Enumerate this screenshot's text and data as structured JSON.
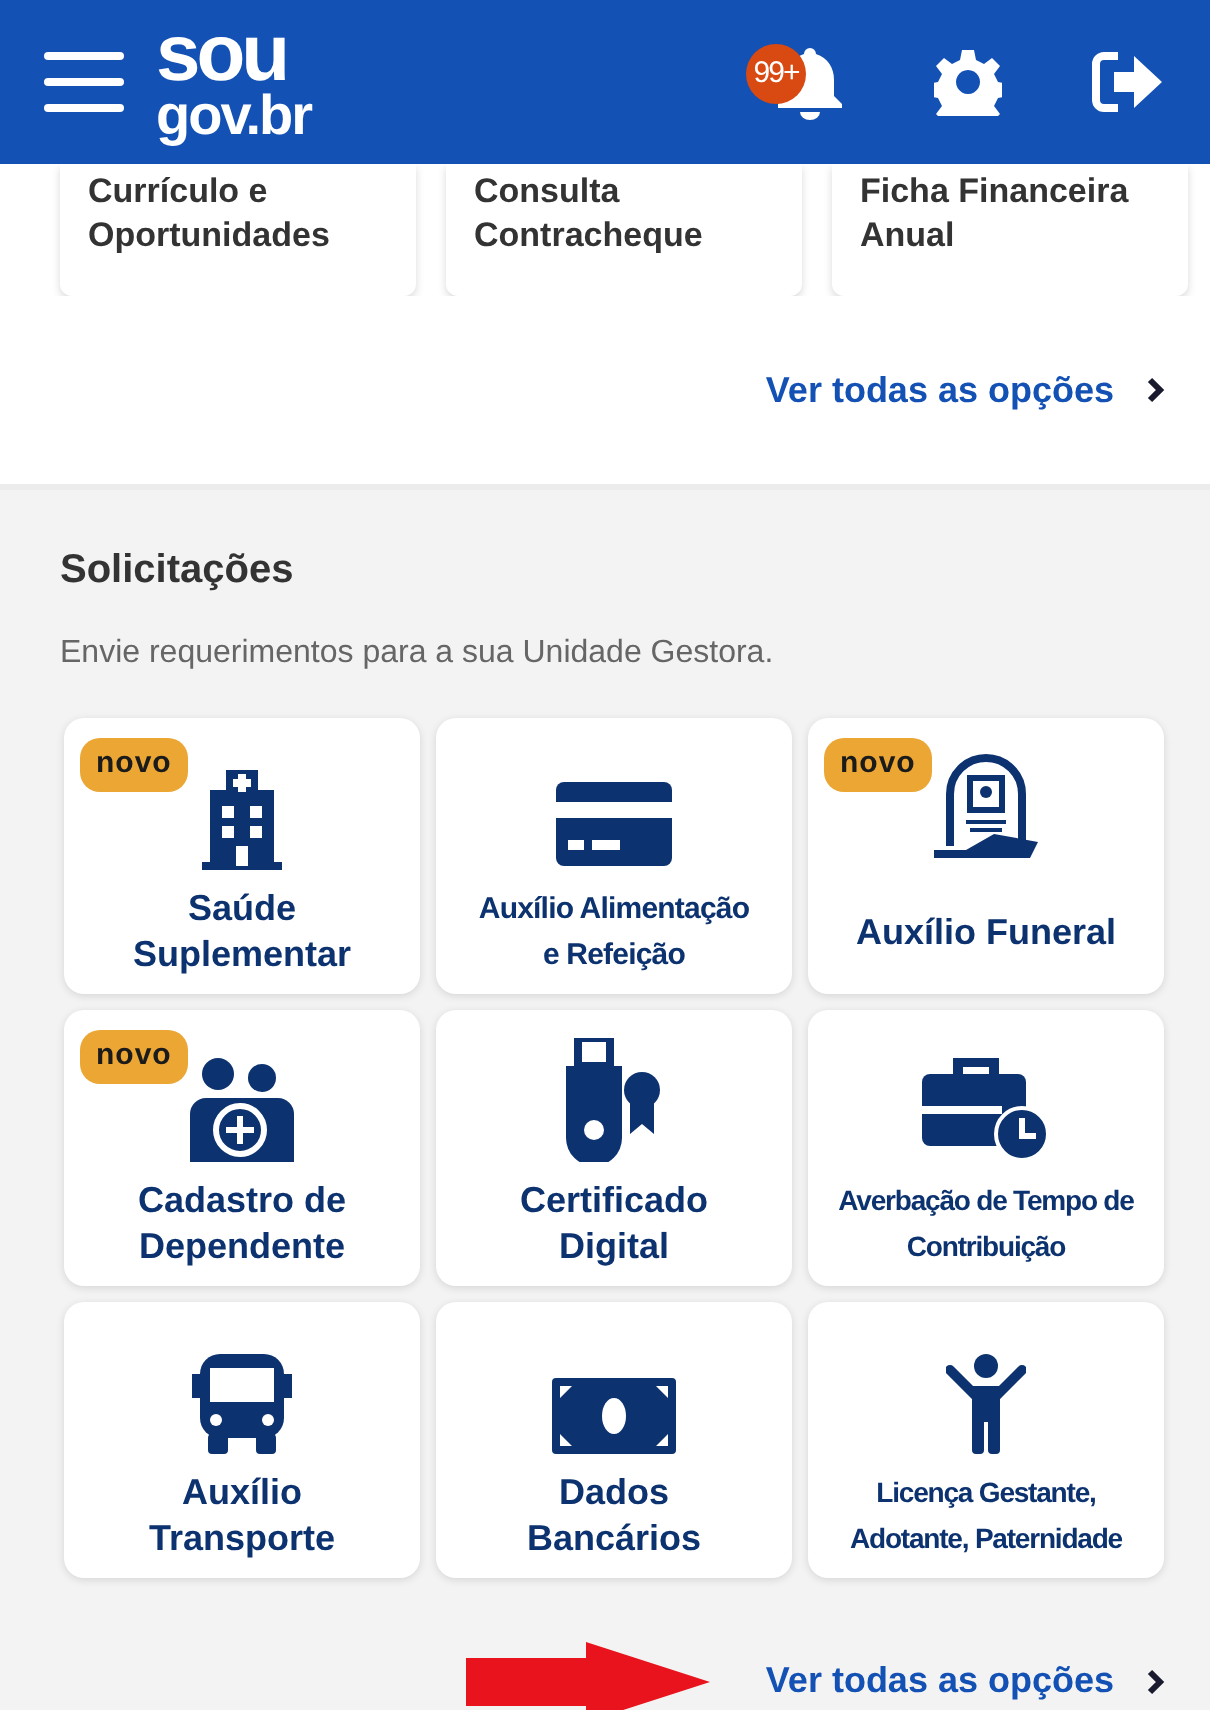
{
  "header": {
    "logo_top": "sou",
    "logo_bottom": "gov.br",
    "notification_count": "99+"
  },
  "top_cards": [
    {
      "label": "Currículo e Oportunidades"
    },
    {
      "label": "Consulta Contracheque"
    },
    {
      "label": "Ficha Financeira Anual"
    }
  ],
  "top_link": "Ver todas as opções",
  "section": {
    "title": "Solicitações",
    "subtitle": "Envie requerimentos para a sua Unidade Gestora.",
    "tiles": [
      {
        "label": "Saúde\nSuplementar",
        "badge": "novo"
      },
      {
        "label": "Auxílio Alimentação\ne Refeição"
      },
      {
        "label": "Auxílio Funeral",
        "badge": "novo"
      },
      {
        "label": "Cadastro de\nDependente",
        "badge": "novo"
      },
      {
        "label": "Certificado\nDigital"
      },
      {
        "label": "Averbação de Tempo de\nContribuição"
      },
      {
        "label": "Auxílio\nTransporte"
      },
      {
        "label": "Dados\nBancários"
      },
      {
        "label": "Licença Gestante,\nAdotante, Paternidade"
      }
    ],
    "link": "Ver todas as opções"
  }
}
